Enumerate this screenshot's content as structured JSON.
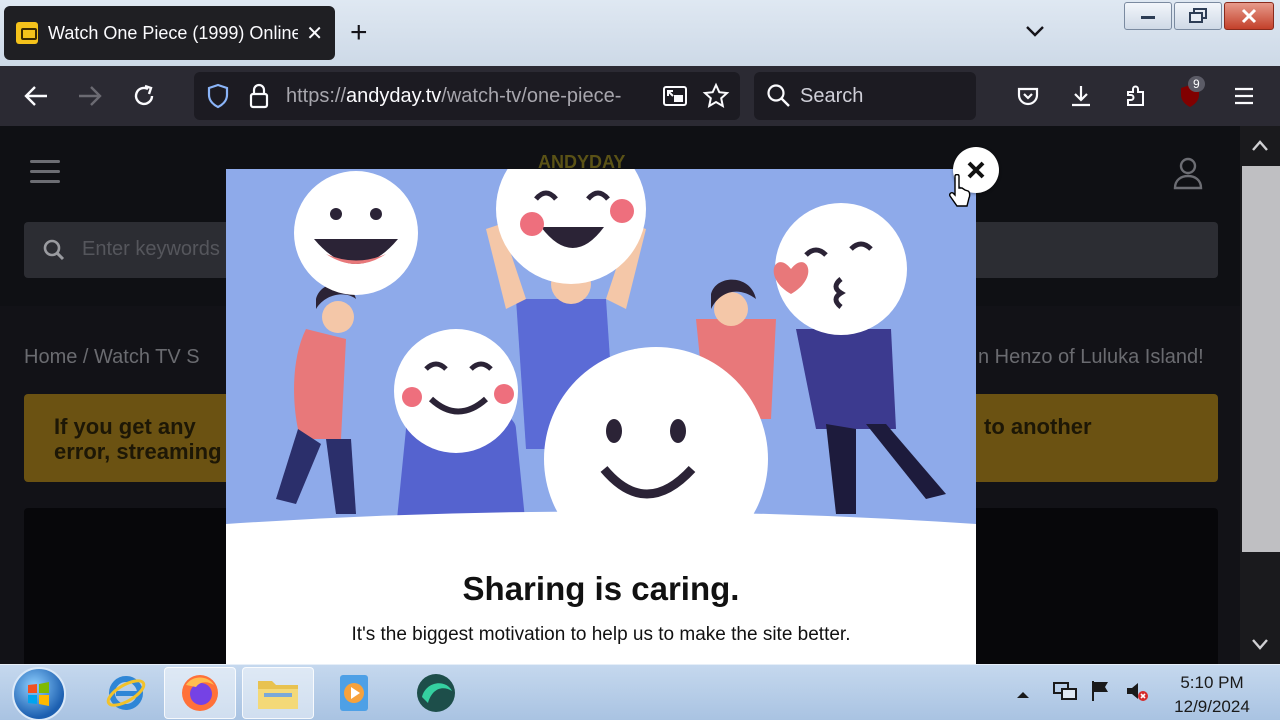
{
  "browser": {
    "tab": {
      "title": "Watch One Piece (1999) Online"
    },
    "url": {
      "scheme": "https://",
      "domain": "andyday.tv",
      "path": "/watch-tv/one-piece-"
    },
    "search": {
      "placeholder": "Search"
    },
    "extension_badge": "9"
  },
  "site": {
    "search": {
      "placeholder": "Enter keywords"
    },
    "breadcrumb": {
      "start": "Home  /   Watch TV S",
      "end": "n Henzo of Luluka Island!"
    },
    "notice": {
      "left": "If you get any error, streaming server",
      "right": "to another"
    },
    "logo": "ANDYDAY"
  },
  "modal": {
    "heading": "Sharing is caring.",
    "subtext": "It's the biggest motivation to help us to make the site better."
  },
  "taskbar": {
    "clock": {
      "time": "5:10 PM",
      "date": "12/9/2024"
    }
  },
  "colors": {
    "illustration_bg": "#8eaaea",
    "tab_bg": "#1f1f23",
    "toolbar_bg": "#2b2a33",
    "notice_bg": "#6b5212"
  }
}
